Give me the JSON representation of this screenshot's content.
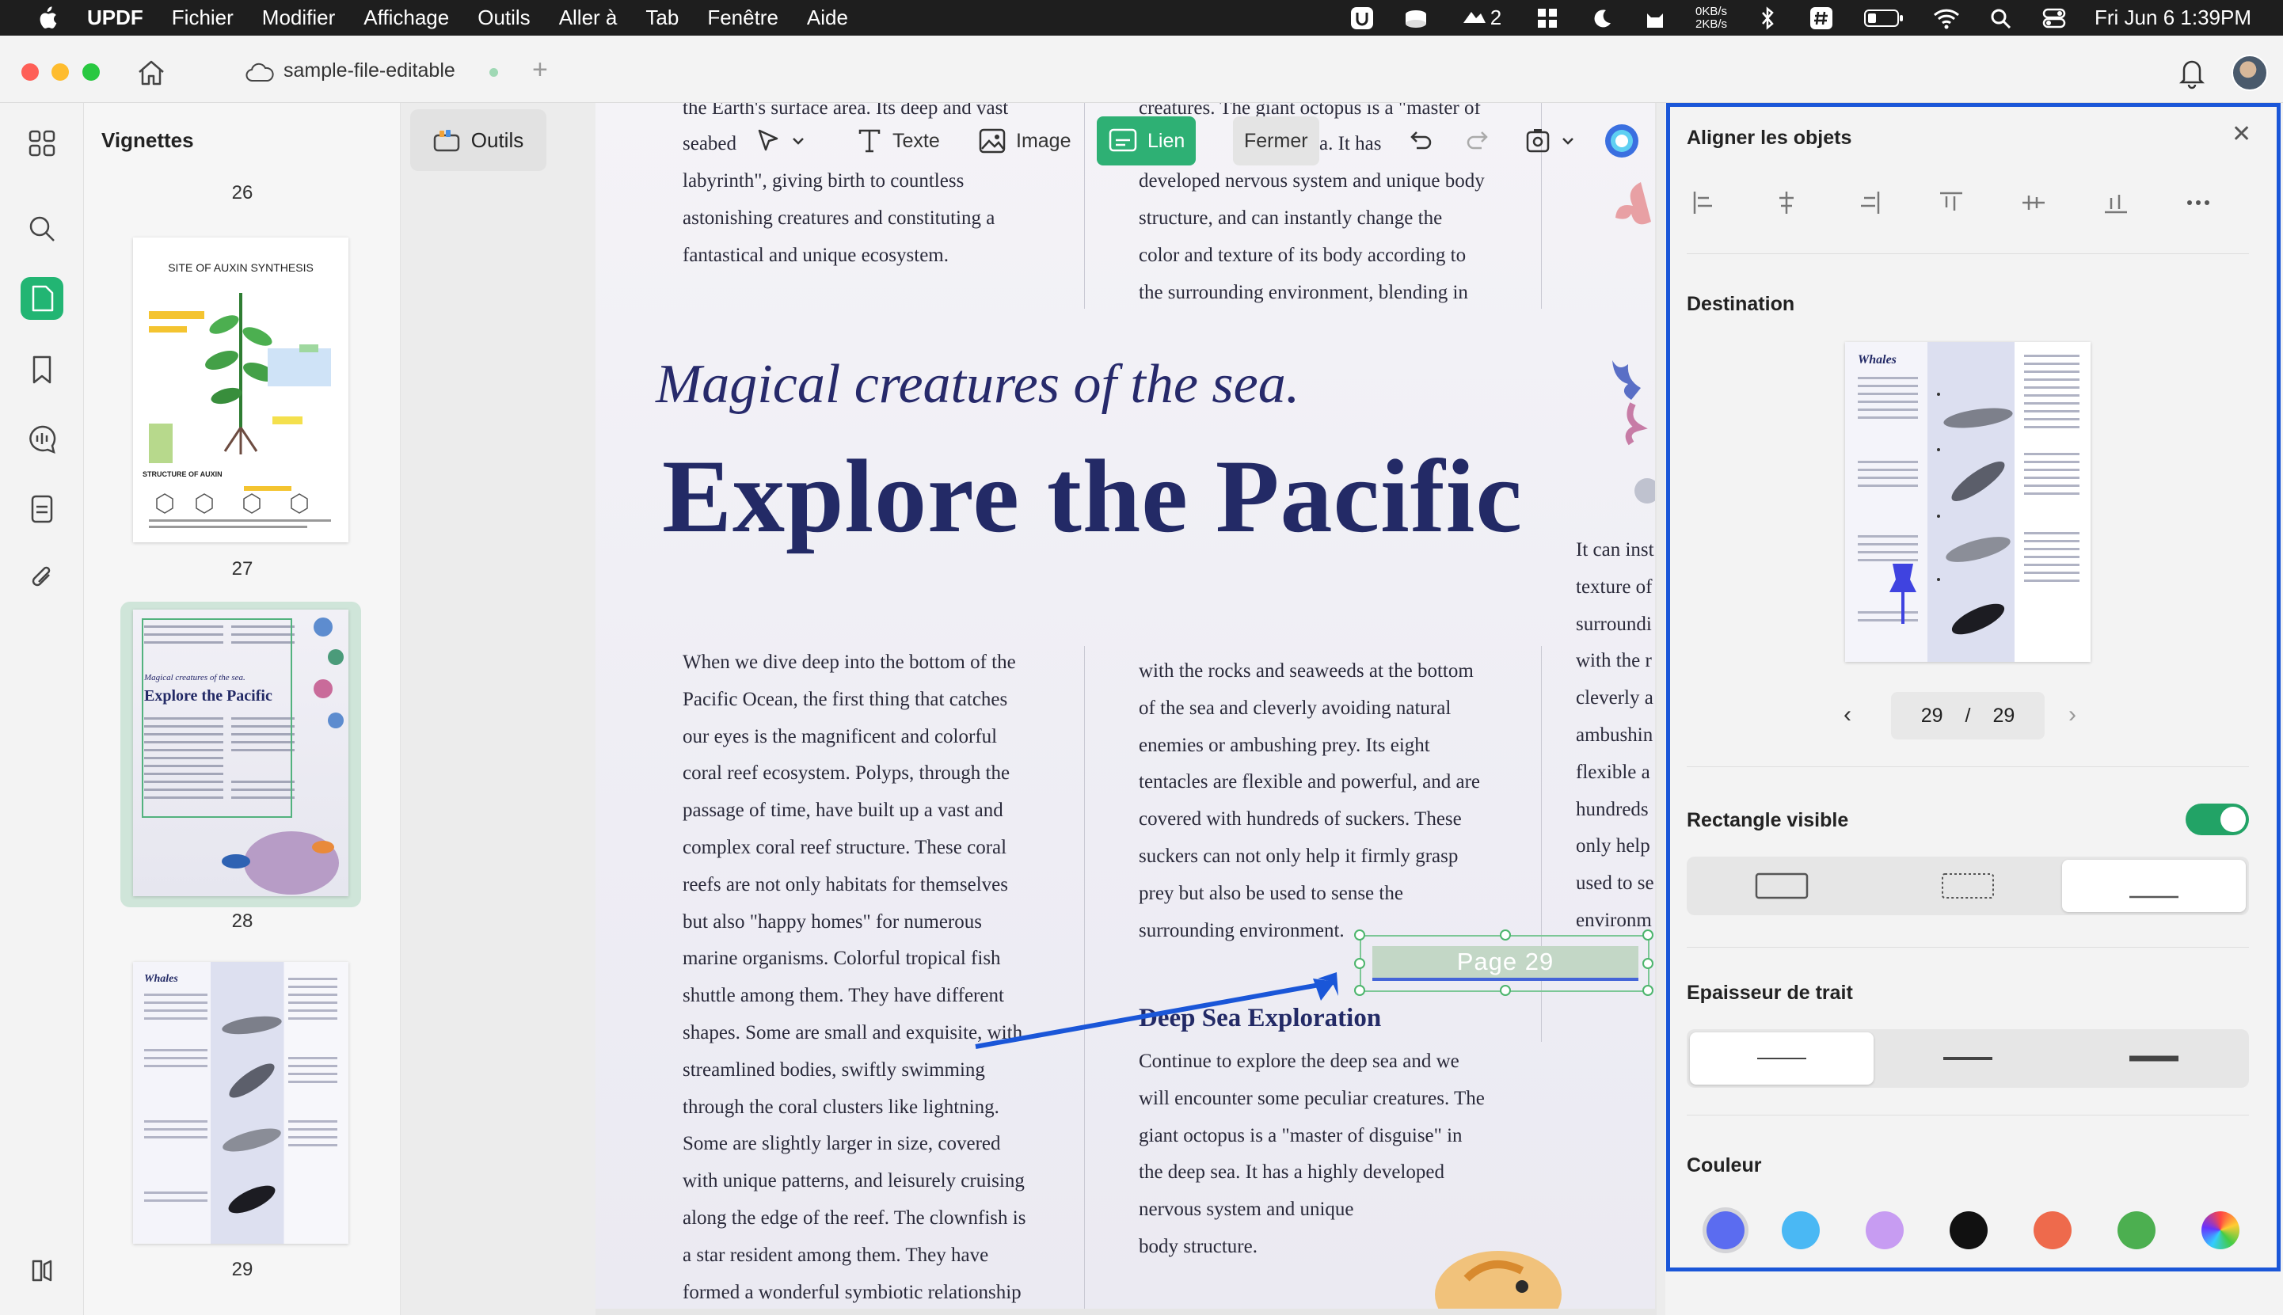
{
  "menubar": {
    "app": "UPDF",
    "items": [
      "Fichier",
      "Modifier",
      "Affichage",
      "Outils",
      "Aller à",
      "Tab",
      "Fenêtre",
      "Aide"
    ],
    "network_up": "0KB/s",
    "network_down": "2KB/s",
    "badge_count": "2",
    "clock": "Fri Jun 6  1:39PM"
  },
  "window": {
    "tab_title": "sample-file-editable"
  },
  "thumbnails": {
    "title": "Vignettes",
    "page_numbers": [
      "26",
      "27",
      "28",
      "29"
    ],
    "p27_title": "SITE OF AUXIN SYNTHESIS",
    "p27_structure": "STRUCTURE OF AUXIN",
    "p28_italic": "Magical creatures of the sea.",
    "p28_title": "Explore the Pacific",
    "p29_title": "Whales"
  },
  "toolbar": {
    "outils": "Outils",
    "texte": "Texte",
    "image": "Image",
    "lien": "Lien",
    "fermer": "Fermer"
  },
  "document": {
    "top_left_lines": [
      "the Earth's surface area. Its deep and vast",
      "seabed",
      "labyrinth\", giving birth to countless",
      "astonishing creatures and constituting a",
      "fantastical and unique ecosystem."
    ],
    "top_right_lines": [
      "creatures. The giant octopus is a \"master of",
      "a. It has",
      "developed nervous system and unique body",
      "structure, and can instantly change the",
      "color and texture of its body according to",
      "the surrounding environment, blending in"
    ],
    "italic_heading": "Magical creatures of the sea.",
    "big_heading": "Explore the Pacific",
    "left_col": [
      "When we dive deep into the bottom of the",
      "Pacific Ocean, the first thing that catches",
      "our eyes is the magnificent and colorful",
      "coral reef ecosystem. Polyps, through the",
      "passage of time, have built up a vast and",
      "complex coral reef structure. These coral",
      "reefs are not only habitats for themselves",
      "but also \"happy homes\" for numerous",
      "marine organisms. Colorful tropical fish",
      "shuttle among them. They have different",
      "shapes. Some are small and exquisite, with",
      "streamlined bodies, swiftly swimming",
      "through the coral clusters like lightning.",
      "Some are slightly larger in size, covered",
      "with unique patterns, and leisurely cruising",
      "along the edge of the reef. The clownfish is",
      "a star resident among them. They have",
      "formed a wonderful symbiotic relationship"
    ],
    "mid_col": [
      "with the rocks and seaweeds at the bottom",
      "of the sea and cleverly avoiding natural",
      "enemies or ambushing prey. Its eight",
      "tentacles are flexible and powerful, and are",
      "covered with hundreds of suckers. These",
      "suckers can not only help it firmly grasp",
      "prey but also be used to sense the",
      "surrounding environment."
    ],
    "right_col": [
      "It can inst",
      "texture of",
      "surroundi",
      "with the r",
      "cleverly a",
      "ambushin",
      "flexible a",
      "hundreds",
      "only help",
      "used to se",
      "environm"
    ],
    "section_heading": "Deep Sea Exploration",
    "section_body": [
      "Continue to explore the deep sea and we",
      "will encounter some peculiar creatures. The",
      "giant octopus is a \"master of disguise\" in",
      "the deep sea. It has a highly developed",
      "nervous system and unique",
      "body structure."
    ],
    "link_label": "Page 29"
  },
  "panel": {
    "align_title": "Aligner les objets",
    "destination_title": "Destination",
    "dest_thumb_title": "Whales",
    "page_current": "29",
    "page_separator": "/",
    "page_total": "29",
    "rect_visible_title": "Rectangle visible",
    "rect_visible_on": true,
    "stroke_title": "Epaisseur de trait",
    "color_title": "Couleur",
    "colors": [
      "#5b6cf0",
      "#4ab8f4",
      "#c79cf2",
      "#111111",
      "#ee6a4c",
      "#4caf50"
    ],
    "selected_color_index": 0
  }
}
